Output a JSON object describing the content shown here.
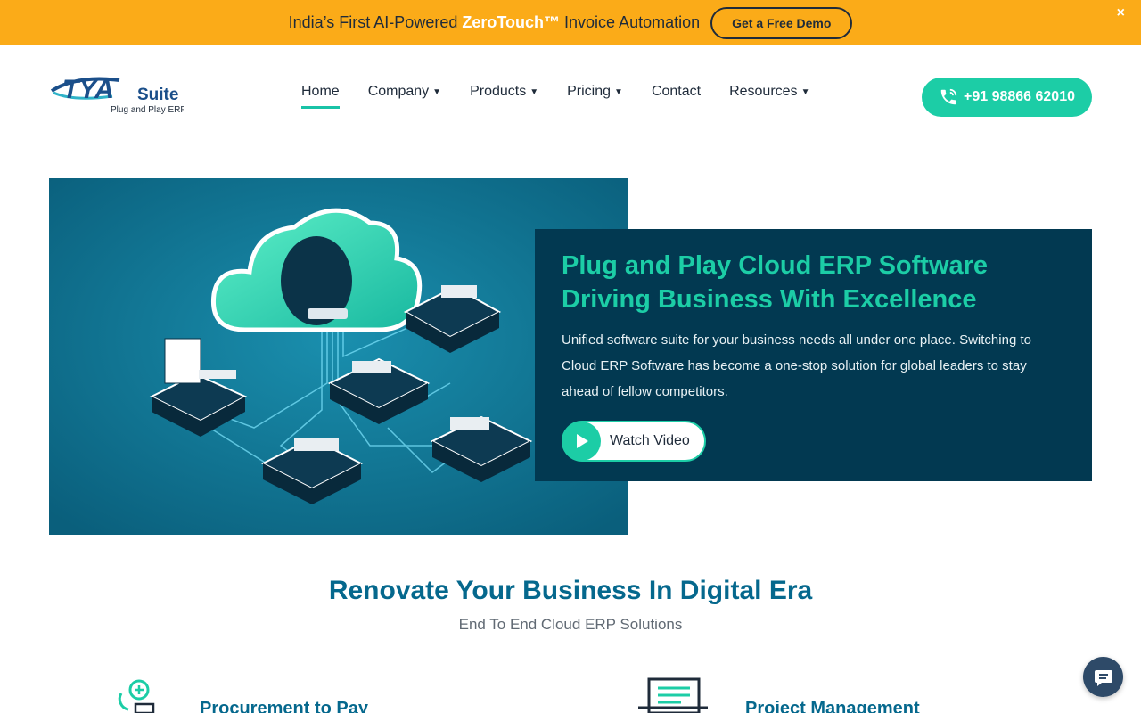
{
  "banner": {
    "text_before": "India’s First AI-Powered ",
    "brand": "ZeroTouch™",
    "text_after": " Invoice Automation",
    "cta_label": "Get a Free Demo",
    "close_label": "×"
  },
  "logo": {
    "main": "TYA",
    "suite": "Suite",
    "tagline": "Plug and Play ERP"
  },
  "nav": {
    "items": [
      {
        "label": "Home",
        "dropdown": false
      },
      {
        "label": "Company",
        "dropdown": true
      },
      {
        "label": "Products",
        "dropdown": true
      },
      {
        "label": "Pricing",
        "dropdown": true
      },
      {
        "label": "Contact",
        "dropdown": false
      },
      {
        "label": "Resources",
        "dropdown": true
      }
    ],
    "caret": "▼"
  },
  "phone": {
    "label": "+91 98866 62010"
  },
  "hero": {
    "title_line1": "Plug and Play Cloud ERP Software",
    "title_line2": "Driving Business With Excellence",
    "description": "Unified software suite for your business needs all under one place. Switching to Cloud ERP Software has become a one-stop solution for global leaders to stay ahead of fellow competitors.",
    "watch_label": "Watch Video"
  },
  "section": {
    "title": "Renovate Your Business In Digital Era",
    "subtitle": "End To End Cloud ERP Solutions"
  },
  "features": [
    {
      "title": "Procurement to Pay"
    },
    {
      "title": "Project Management"
    }
  ],
  "colors": {
    "banner": "#fbab18",
    "accent": "#1ccda6",
    "brand_blue": "#05688d",
    "hero_card": "#023951"
  }
}
